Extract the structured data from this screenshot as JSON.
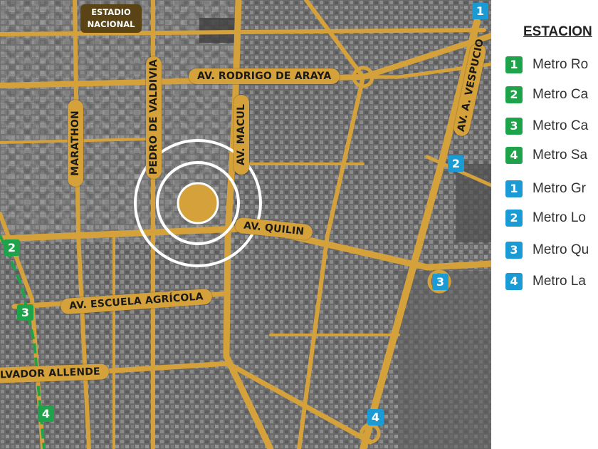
{
  "map": {
    "landmark": {
      "line1": "ESTADIO",
      "line2": "NACIONAL"
    },
    "roads": {
      "rodrigo_de_araya": "AV. RODRIGO DE ARAYA",
      "marathon": "MARATHON",
      "pedro_de_valdivia": "PEDRO DE VALDIVIA",
      "macul": "AV. MACUL",
      "quilin": "AV. QUILIN",
      "escuela_agricola": "AV. ESCUELA AGRÍCOLA",
      "salvador_allende": "LVADOR ALLENDE",
      "vespucio": "AV. A. VESPUCIO"
    },
    "stations": [
      {
        "num": "1",
        "line": "blue"
      },
      {
        "num": "2",
        "line": "blue"
      },
      {
        "num": "3",
        "line": "blue"
      },
      {
        "num": "4",
        "line": "blue"
      },
      {
        "num": "2",
        "line": "green"
      },
      {
        "num": "3",
        "line": "green"
      },
      {
        "num": "4",
        "line": "green"
      }
    ],
    "colors": {
      "road": "#d4a13a",
      "green_line": "#1ea34a",
      "blue_line": "#1a9bd6",
      "site": "#d4a13a"
    }
  },
  "legend": {
    "title": "ESTACION",
    "items": [
      {
        "num": "1",
        "line": "green",
        "label": "Metro Ro"
      },
      {
        "num": "2",
        "line": "green",
        "label": "Metro Ca"
      },
      {
        "num": "3",
        "line": "green",
        "label": "Metro Ca"
      },
      {
        "num": "4",
        "line": "green",
        "label": "Metro Sa"
      },
      {
        "num": "1",
        "line": "blue",
        "label": "Metro Gr"
      },
      {
        "num": "2",
        "line": "blue",
        "label": "Metro Lo"
      },
      {
        "num": "3",
        "line": "blue",
        "label": "Metro Qu"
      },
      {
        "num": "4",
        "line": "blue",
        "label": "Metro La"
      }
    ]
  }
}
